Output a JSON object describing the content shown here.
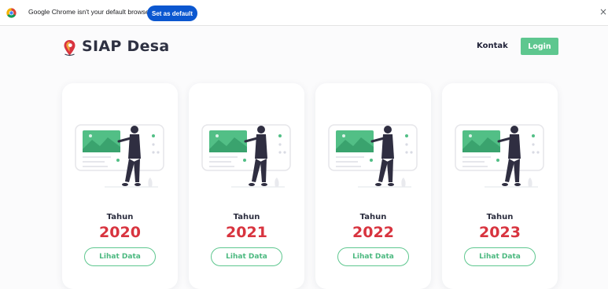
{
  "infobar": {
    "icon": "chrome-icon",
    "message": "Google Chrome isn't your default browser",
    "set_default_label": "Set as default",
    "close_label": "×"
  },
  "header": {
    "logo_icon": "pin-map-icon",
    "brand": "SIAP Desa",
    "nav_kontak": "Kontak",
    "login_label": "Login"
  },
  "colors": {
    "accent_green": "#5ec78f",
    "year_red": "#d8343f",
    "chrome_blue": "#0b57d0",
    "dark_text": "#2e3142"
  },
  "cards": [
    {
      "heading": "Tahun",
      "year": "2020",
      "button_label": "Lihat Data",
      "illustration": "presentation-illustration"
    },
    {
      "heading": "Tahun",
      "year": "2021",
      "button_label": "Lihat Data",
      "illustration": "presentation-illustration"
    },
    {
      "heading": "Tahun",
      "year": "2022",
      "button_label": "Lihat Data",
      "illustration": "presentation-illustration"
    },
    {
      "heading": "Tahun",
      "year": "2023",
      "button_label": "Lihat Data",
      "illustration": "presentation-illustration"
    }
  ]
}
